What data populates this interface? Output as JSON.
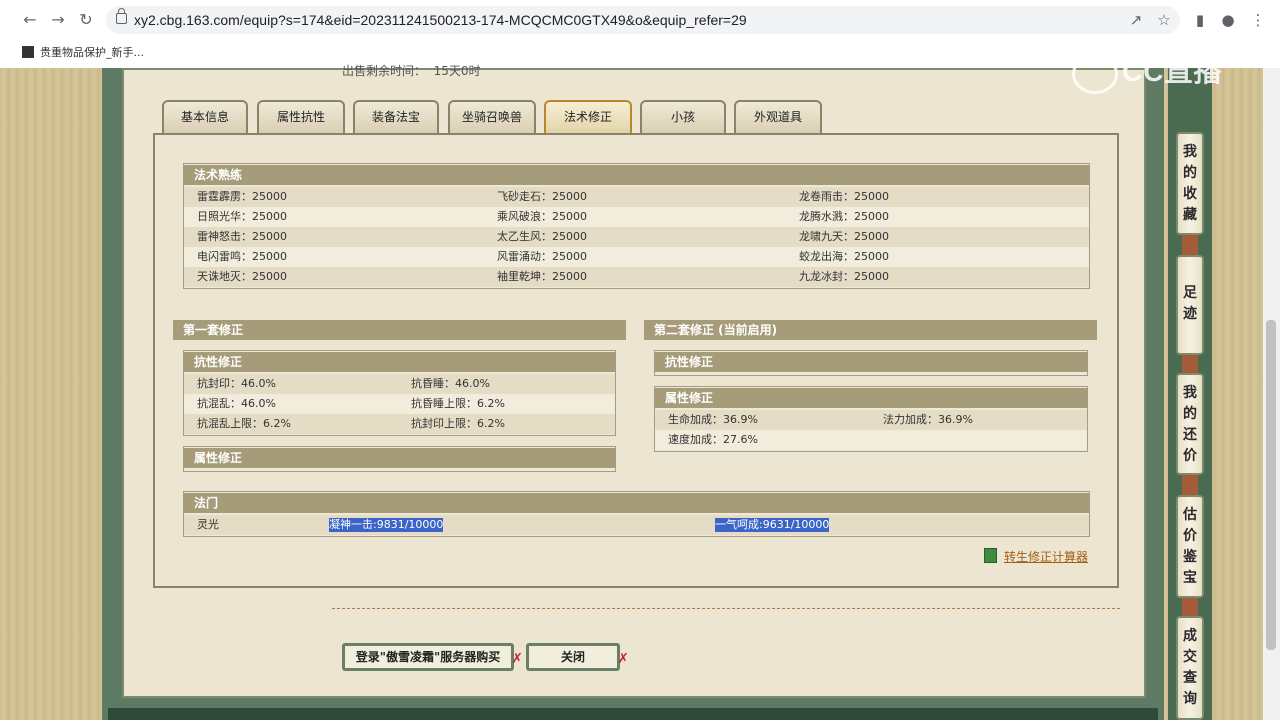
{
  "browser": {
    "url": "xy2.cbg.163.com/equip?s=174&eid=202311241500213-174-MCQCMC0GTX49&o&equip_refer=29",
    "bookmark": "贵重物品保护_新手...",
    "watermark": "CC直播"
  },
  "page": {
    "sell_time_label": "出售剩余时间：",
    "sell_time_value": "15天0时"
  },
  "tabs": [
    {
      "label": "基本信息"
    },
    {
      "label": "属性抗性"
    },
    {
      "label": "装备法宝"
    },
    {
      "label": "坐骑召唤兽"
    },
    {
      "label": "法术修正",
      "active": true
    },
    {
      "label": "小孩"
    },
    {
      "label": "外观道具"
    }
  ],
  "skills": {
    "title": "法术熟练",
    "rows": [
      [
        "雷霆霹雳：25000",
        "飞砂走石：25000",
        "龙卷雨击：25000"
      ],
      [
        "日照光华：25000",
        "乘风破浪：25000",
        "龙腾水溅：25000"
      ],
      [
        "雷神怒击：25000",
        "太乙生风：25000",
        "龙啸九天：25000"
      ],
      [
        "电闪雷鸣：25000",
        "风雷涌动：25000",
        "蛟龙出海：25000"
      ],
      [
        "天诛地灭：25000",
        "袖里乾坤：25000",
        "九龙冰封：25000"
      ]
    ]
  },
  "set1": {
    "title": "第一套修正",
    "resist_title": "抗性修正",
    "resist_rows": [
      [
        "抗封印：46.0%",
        "抗昏睡：46.0%"
      ],
      [
        "抗混乱：46.0%",
        "抗昏睡上限：6.2%"
      ],
      [
        "抗混乱上限：6.2%",
        "抗封印上限：6.2%"
      ]
    ],
    "attr_title": "属性修正"
  },
  "set2": {
    "title": "第二套修正 (当前启用)",
    "resist_title": "抗性修正",
    "attr_title": "属性修正",
    "attr_rows": [
      [
        "生命加成：36.9%",
        "法力加成：36.9%"
      ],
      [
        "速度加成：27.6%",
        ""
      ]
    ]
  },
  "famen": {
    "title": "法门",
    "name": "灵光",
    "v1": "凝神一击:9831/10000",
    "v2": "一气呵成:9631/10000"
  },
  "calc_link": "转生修正计算器",
  "buttons": {
    "login": "登录\"傲雪凌霜\"服务器购买",
    "close": "关闭"
  },
  "sidebar": [
    {
      "label": "我的收藏"
    },
    {
      "label": "足迹"
    },
    {
      "label": "我的还价"
    },
    {
      "label": "估价鉴宝"
    },
    {
      "label": "成交查询"
    }
  ]
}
